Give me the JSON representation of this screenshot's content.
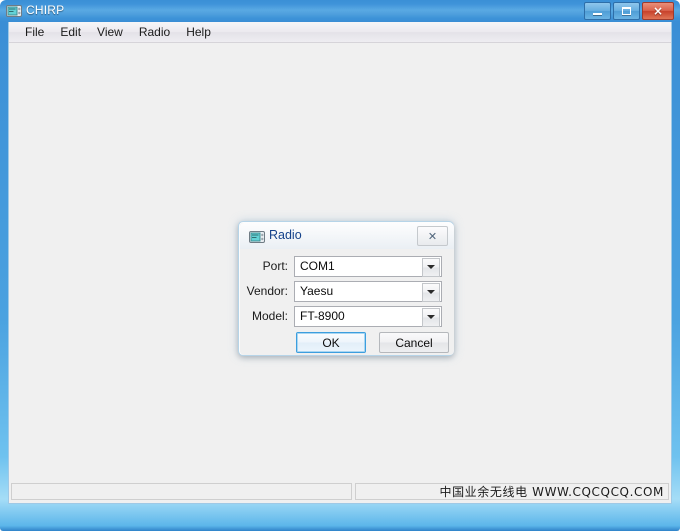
{
  "window": {
    "title": "CHIRP",
    "icon": "radio-icon",
    "controls": {
      "minimize": "minimize-icon",
      "maximize": "maximize-icon",
      "close": "×"
    }
  },
  "menu": {
    "items": [
      {
        "label": "File"
      },
      {
        "label": "Edit"
      },
      {
        "label": "View"
      },
      {
        "label": "Radio"
      },
      {
        "label": "Help"
      }
    ]
  },
  "status_bar": {
    "left_panel_text": "",
    "right_panel_text": "中国业余无线电 WWW.CQCQCQ.COM"
  },
  "dialog": {
    "title": "Radio",
    "icon": "radio-icon",
    "close_glyph": "✕",
    "fields": [
      {
        "label": "Port:",
        "value": "COM1",
        "name": "port",
        "arrow": "chevron-down-icon"
      },
      {
        "label": "Vendor:",
        "value": "Yaesu",
        "name": "vendor",
        "arrow": "chevron-down-icon"
      },
      {
        "label": "Model:",
        "value": "FT-8900",
        "name": "model",
        "arrow": "chevron-down-icon"
      }
    ],
    "buttons": {
      "ok": "OK",
      "cancel": "Cancel"
    }
  },
  "colors": {
    "frame_blue": "#3a8fd6",
    "client_bg": "#f0f0f0",
    "dialog_title_text": "#15428b",
    "focus_blue": "#3c9ede",
    "close_red": "#c7412b"
  }
}
